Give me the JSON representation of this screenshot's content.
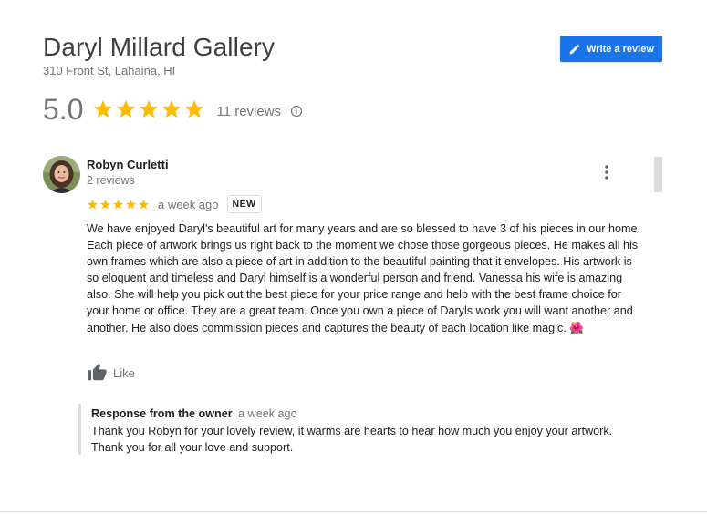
{
  "place": {
    "name": "Daryl Millard Gallery",
    "address": "310 Front St, Lahaina, HI"
  },
  "write_review": {
    "label": "Write a review",
    "icon": "pencil-icon"
  },
  "summary": {
    "rating": "5.0",
    "stars": 5,
    "review_count": "11 reviews",
    "info_icon": "info-icon"
  },
  "review": {
    "author": "Robyn Curletti",
    "author_meta": "2 reviews",
    "stars": 5,
    "time": "a week ago",
    "badge": "NEW",
    "text": "We have enjoyed Daryl's beautiful art for many years and are so blessed to have 3 of his pieces in our home. Each piece of artwork brings us right back to the moment we chose those gorgeous pieces. He makes all his own frames which are also a piece of art in addition to the beautiful painting that it envelopes. His artwork is so eloquent and timeless and Daryl himself is a wonderful person and friend. Vanessa his wife is amazing also. She will help you pick out the best piece for your price range and help with the best frame choice for your home or office. They are a great team. Once you own a piece of Daryls work you will want another and another. He also does commission pieces and captures the beauty of each location like magic.",
    "emoji": "🌺",
    "like_label": "Like"
  },
  "owner_response": {
    "label": "Response from the owner",
    "time": "a week ago",
    "text": "Thank you Robyn for your lovely review, it warms are hearts to hear how much you enjoy your artwork. Thank you for all your love and support."
  },
  "colors": {
    "accent": "#1a73e8",
    "star": "#fbbc04",
    "muted": "#70757a"
  }
}
